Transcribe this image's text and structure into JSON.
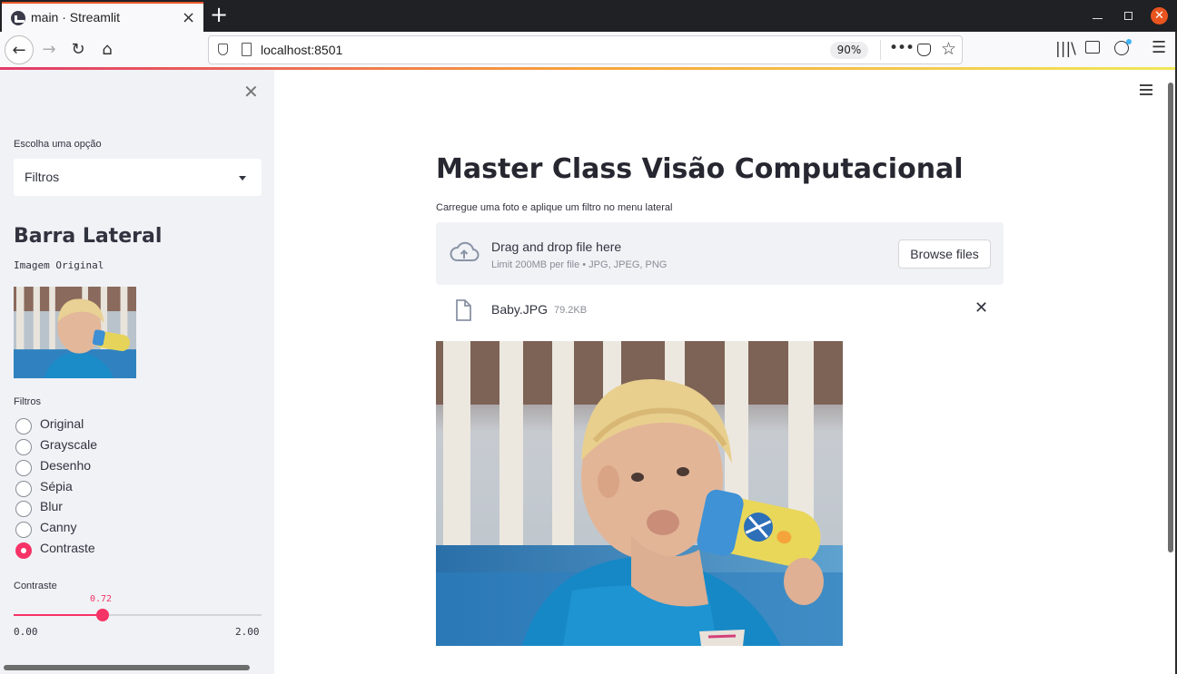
{
  "browser": {
    "tab_title": "main · Streamlit",
    "new_tab": "+",
    "url": "localhost:8501",
    "zoom": "90%",
    "colors": {
      "accent": "#e8572a",
      "chrome": "#202124"
    }
  },
  "sidebar": {
    "select_label": "Escolha uma opção",
    "select_value": "Filtros",
    "title": "Barra Lateral",
    "image_caption": "Imagem Original",
    "filters_label": "Filtros",
    "filters": [
      {
        "label": "Original",
        "selected": false
      },
      {
        "label": "Grayscale",
        "selected": false
      },
      {
        "label": "Desenho",
        "selected": false
      },
      {
        "label": "Sépia",
        "selected": false
      },
      {
        "label": "Blur",
        "selected": false
      },
      {
        "label": "Canny",
        "selected": false
      },
      {
        "label": "Contraste",
        "selected": true
      }
    ],
    "slider": {
      "label": "Contraste",
      "value": "0.72",
      "min": "0.00",
      "max": "2.00",
      "value_num": 0.72,
      "min_num": 0,
      "max_num": 2
    },
    "colors": {
      "accent": "#f63366",
      "background": "#f0f2f6"
    }
  },
  "main": {
    "title": "Master Class Visão Computacional",
    "caption": "Carregue uma foto e aplique um filtro no menu lateral",
    "uploader": {
      "title": "Drag and drop file here",
      "hint": "Limit 200MB per file • JPG, JPEG, PNG",
      "button": "Browse files"
    },
    "file": {
      "name": "Baby.JPG",
      "size": "79.2KB"
    }
  }
}
